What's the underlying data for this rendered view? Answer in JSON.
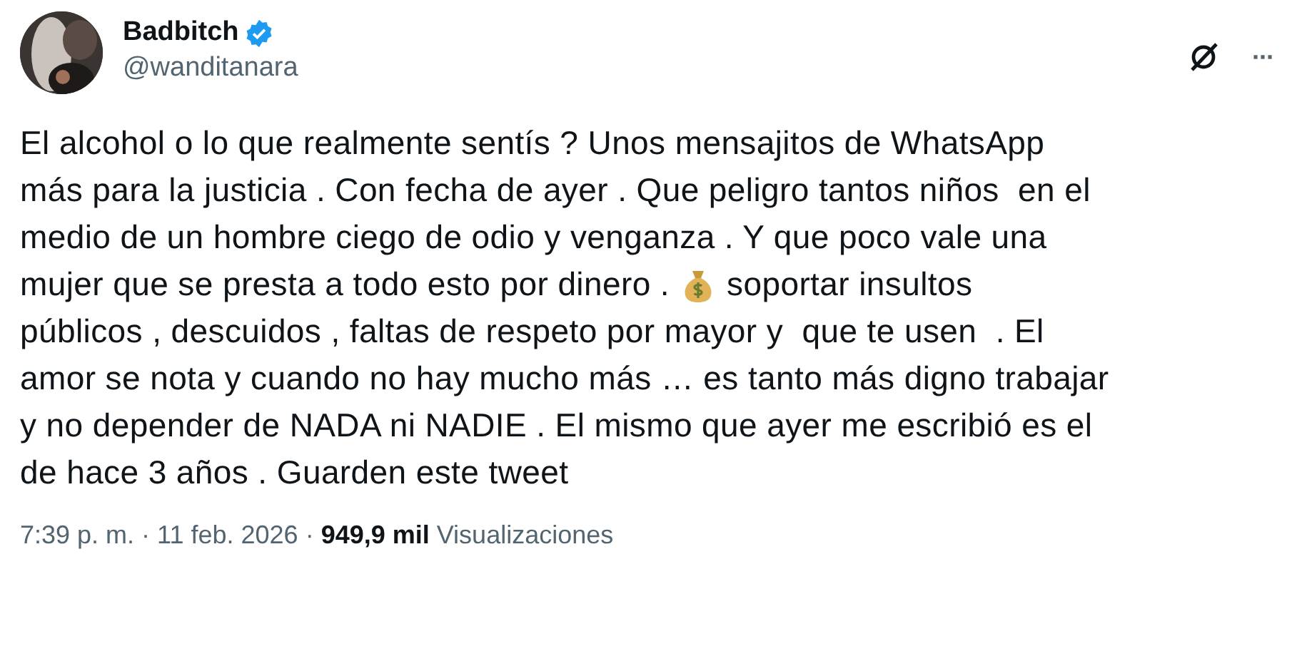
{
  "author": {
    "name": "Badbitch",
    "verified": true,
    "handle": "@wanditanara"
  },
  "body": {
    "lines": [
      {
        "parts": [
          "El alcohol o lo que realmente sentís ? Unos mensajitos de WhatsApp"
        ]
      },
      {
        "parts": [
          "más para la justicia . Con fecha de ayer . Que peligro tantos niños  en el"
        ]
      },
      {
        "parts": [
          "medio de un hombre ciego de odio y venganza . Y que poco vale una"
        ]
      },
      {
        "parts": [
          "mujer que se presta a todo esto por dinero .",
          "soportar insultos"
        ]
      },
      {
        "parts": [
          "públicos , descuidos , faltas de respeto por mayor y  que te usen  . El"
        ]
      },
      {
        "parts": [
          "amor se nota y cuando no hay mucho más … es tanto más digno trabajar"
        ]
      },
      {
        "parts": [
          "y no depender de NADA ni NADIE . El mismo que ayer me escribió es el"
        ]
      },
      {
        "parts": [
          "de hace 3 años . Guarden este tweet"
        ]
      }
    ]
  },
  "meta": {
    "time": "7:39 p. m.",
    "separator_1": "·",
    "date": "11 feb. 2026",
    "separator_2": "·",
    "views_count": "949,9 mil",
    "views_label": "Visualizaciones"
  },
  "more_menu": "···"
}
